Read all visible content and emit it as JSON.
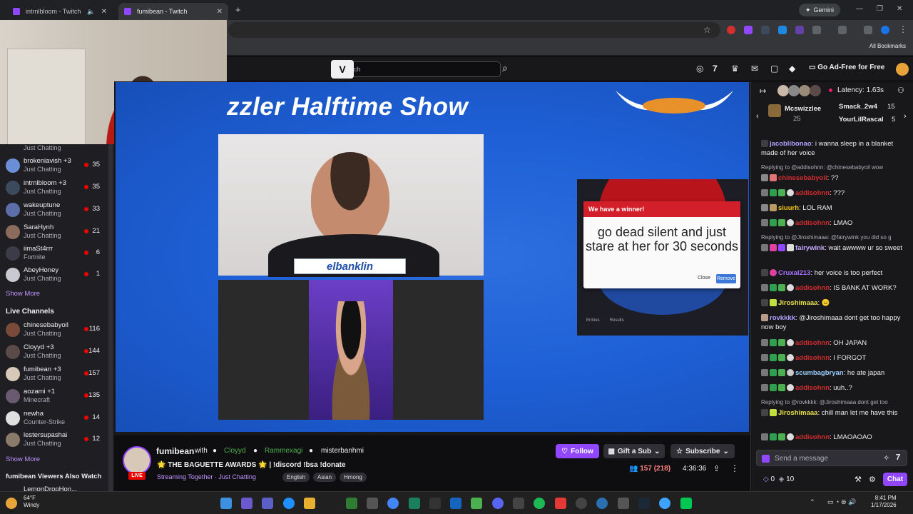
{
  "browser": {
    "tabs": [
      {
        "title": "intrnlbloom - Twitch"
      },
      {
        "title": "fumibean - Twitch"
      }
    ],
    "new_tab_symbol": "+",
    "gemini_label": "Gemini",
    "all_bookmarks": "All Bookmarks"
  },
  "twitch_nav": {
    "search_visible_text": "ch",
    "ad_free": "Go Ad-Free for Free"
  },
  "sidebar": {
    "top_game": "Just Chatting",
    "followed": [
      {
        "name": "brokeniavish +3",
        "game": "Just Chatting",
        "viewers": "35",
        "color": "#6b8fd6"
      },
      {
        "name": "intrnlbloom +3",
        "game": "Just Chatting",
        "viewers": "35",
        "color": "#3b4a5c"
      },
      {
        "name": "wakeuptune",
        "game": "Just Chatting",
        "viewers": "33",
        "color": "#5c6ea8"
      },
      {
        "name": "SaraHynh",
        "game": "Just Chatting",
        "viewers": "21",
        "color": "#8a6b5c"
      },
      {
        "name": "iimaSt4rrr",
        "game": "Fortnite",
        "viewers": "6",
        "color": "#3c3c48"
      },
      {
        "name": "AbeyHoney",
        "game": "Just Chatting",
        "viewers": "1",
        "color": "#c8c8d0"
      }
    ],
    "show_more_1": "Show More",
    "live_channels_heading": "Live Channels",
    "live": [
      {
        "name": "chinesebabyoil",
        "game": "Just Chatting",
        "viewers": "116",
        "color": "#7a4a3a"
      },
      {
        "name": "Cloyyd +3",
        "game": "Just Chatting",
        "viewers": "144",
        "color": "#5a4a48"
      },
      {
        "name": "fumibean +3",
        "game": "Just Chatting",
        "viewers": "157",
        "color": "#d8c8b8"
      },
      {
        "name": "aozami +1",
        "game": "Minecraft",
        "viewers": "135",
        "color": "#6a5a70"
      },
      {
        "name": "newha",
        "game": "Counter-Strike",
        "viewers": "14",
        "color": "#e0e0e0"
      },
      {
        "name": "lestersupashai",
        "game": "Just Chatting",
        "viewers": "12",
        "color": "#8a7a6a"
      }
    ],
    "show_more_2": "Show More",
    "also_watch_heading": "fumibean Viewers Also Watch",
    "partial_row": "LemonDropHon..."
  },
  "stream": {
    "show_title": "zzler Halftime Show",
    "cam1_label": "elbanklin",
    "wheel": {
      "header": "We have a winner!",
      "result": "go dead silent and just stare at her for 30 seconds",
      "close": "Close",
      "remove": "Remove",
      "tab_entries": "Entries",
      "tab_results": "Results"
    }
  },
  "channel": {
    "name": "fumibean",
    "with": "with",
    "collaborators": [
      "Cloyyd",
      "Rammexagi",
      "misterbanhmi"
    ],
    "live_badge": "LIVE",
    "title": "🌟 THE BAGUETTE AWARDS 🌟 | !discord !bsa !donate",
    "category": "Streaming Together · Just Chatting",
    "tags": [
      "English",
      "Asian",
      "Hmong"
    ],
    "follow": "Follow",
    "gift": "Gift a Sub",
    "subscribe": "Subscribe",
    "viewers": "157 (218)",
    "uptime": "4:36:36"
  },
  "chat": {
    "latency": "Latency: 1.63s",
    "top_gifter_1": {
      "name": "Mcswizzlee",
      "count": "25"
    },
    "top_gifter_2": {
      "name": "Smack_2w4",
      "count": "15"
    },
    "top_gifter_3": {
      "name": "YourLilRascal",
      "count": "5"
    },
    "messages": [
      {
        "user": "jacoblibonao",
        "color": "#b0a0ff",
        "text": ": i wanna sleep in a blanket made of her voice"
      },
      {
        "reply": "Replying to @addisohnn: @chinesebabyoil wow"
      },
      {
        "user": "chinesebabyoil",
        "color": "#d12c2c",
        "text": ": ??"
      },
      {
        "user": "addisohnn",
        "color": "#d12c2c",
        "text": ": ???"
      },
      {
        "user": "siuurh",
        "color": "#f0c419",
        "text": ": LOL RAM"
      },
      {
        "user": "addisohnn",
        "color": "#d12c2c",
        "text": ": LMAO"
      },
      {
        "reply": "Replying to @Jiroshimaaa: @fairywink you did so g"
      },
      {
        "user": "fairywink",
        "color": "#c6a7ff",
        "text": ": wait awwww ur so sweet"
      },
      {
        "user": "Cruxal213",
        "color": "#a970ff",
        "text": ": her voice is too perfect"
      },
      {
        "user": "addisohnn",
        "color": "#d12c2c",
        "text": ": IS BANK AT WORK?"
      },
      {
        "user": "Jiroshimaaa",
        "color": "#e8e04a",
        "text": ": 😑"
      },
      {
        "user": "rovkkkk",
        "color": "#b0a0ff",
        "text": ": @Jiroshimaaa dont get too happy now boy"
      },
      {
        "user": "addisohnn",
        "color": "#d12c2c",
        "text": ": OH JAPAN"
      },
      {
        "user": "addisohnn",
        "color": "#d12c2c",
        "text": ": I FORGOT"
      },
      {
        "user": "scumbagbryan",
        "color": "#9ad0ff",
        "text": ": he ate japan"
      },
      {
        "user": "addisohnn",
        "color": "#d12c2c",
        "text": ": uuh..?"
      },
      {
        "reply": "Replying to @rovkkkk: @Jiroshimaaa dont get too"
      },
      {
        "user": "Jiroshimaaa",
        "color": "#e8e04a",
        "text": ": chill man let me have this"
      },
      {
        "user": "addisohnn",
        "color": "#d12c2c",
        "text": ": LMAOAOAO"
      }
    ],
    "input_placeholder": "Send a message",
    "points": "0",
    "bits": "10",
    "chat_button": "Chat"
  },
  "taskbar": {
    "temp": "64°F",
    "weather": "Windy",
    "time": "8:41 PM",
    "date": "1/17/2026"
  }
}
